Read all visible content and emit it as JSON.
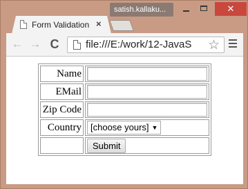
{
  "window": {
    "user_badge": "satish.kallaku...",
    "minimize_icon": "minimize-icon",
    "maximize_icon": "maximize-icon",
    "close_glyph": "✕"
  },
  "tab": {
    "title": "Form Validation",
    "close_glyph": "×"
  },
  "toolbar": {
    "back_glyph": "←",
    "forward_glyph": "→",
    "reload_glyph": "C",
    "url": "file:///E:/work/12-JavaS",
    "star_glyph": "☆"
  },
  "form": {
    "rows": [
      {
        "label": "Name",
        "value": ""
      },
      {
        "label": "EMail",
        "value": ""
      },
      {
        "label": "Zip Code",
        "value": ""
      }
    ],
    "country_label": "Country",
    "country_selected": "[choose yours]",
    "submit_label": "Submit"
  },
  "colors": {
    "frame": "#c99b84",
    "close_button": "#c9483e",
    "toolbar": "#f3f3f3"
  }
}
